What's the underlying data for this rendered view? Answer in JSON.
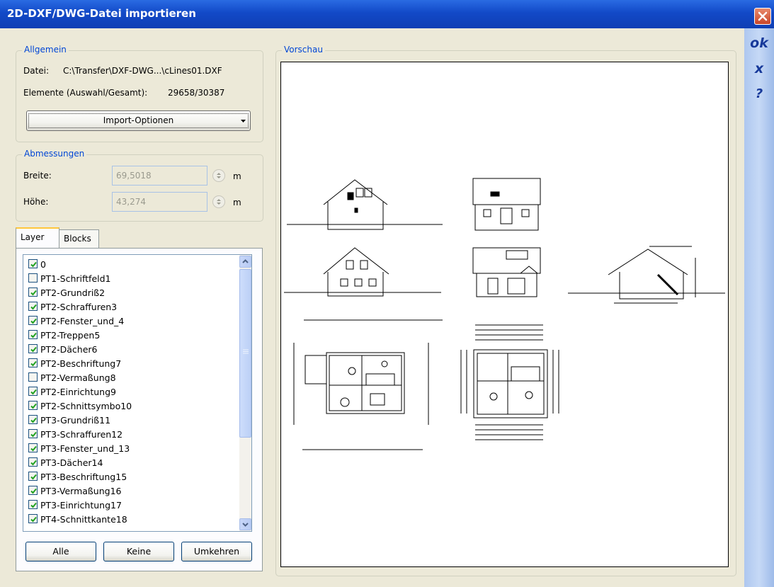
{
  "window": {
    "title": "2D-DXF/DWG-Datei importieren"
  },
  "side_actions": {
    "ok": "ok",
    "cancel": "x",
    "help": "?"
  },
  "allgemein": {
    "legend": "Allgemein",
    "datei_label": "Datei:",
    "datei_value": "C:\\Transfer\\DXF-DWG...\\cLines01.DXF",
    "elemente_label": "Elemente (Auswahl/Gesamt):",
    "elemente_value": "29658/30387",
    "import_options": "Import-Optionen"
  },
  "abmessungen": {
    "legend": "Abmessungen",
    "breite_label": "Breite:",
    "breite_value": "69,5018",
    "hoehe_label": "Höhe:",
    "hoehe_value": "43,274",
    "unit": "m"
  },
  "tabs": [
    "Layer",
    "Blocks"
  ],
  "layers": [
    {
      "name": "0",
      "checked": true
    },
    {
      "name": "PT1-Schriftfeld1",
      "checked": false
    },
    {
      "name": "PT2-Grundriß2",
      "checked": true
    },
    {
      "name": "PT2-Schraffuren3",
      "checked": true
    },
    {
      "name": "PT2-Fenster_und_4",
      "checked": true
    },
    {
      "name": "PT2-Treppen5",
      "checked": true
    },
    {
      "name": "PT2-Dächer6",
      "checked": true
    },
    {
      "name": "PT2-Beschriftung7",
      "checked": true
    },
    {
      "name": "PT2-Vermaßung8",
      "checked": false
    },
    {
      "name": "PT2-Einrichtung9",
      "checked": true
    },
    {
      "name": "PT2-Schnittsymbo10",
      "checked": true
    },
    {
      "name": "PT3-Grundriß11",
      "checked": true
    },
    {
      "name": "PT3-Schraffuren12",
      "checked": true
    },
    {
      "name": "PT3-Fenster_und_13",
      "checked": true
    },
    {
      "name": "PT3-Dächer14",
      "checked": true
    },
    {
      "name": "PT3-Beschriftung15",
      "checked": true
    },
    {
      "name": "PT3-Vermaßung16",
      "checked": true
    },
    {
      "name": "PT3-Einrichtung17",
      "checked": true
    },
    {
      "name": "PT4-Schnittkante18",
      "checked": true
    }
  ],
  "buttons": {
    "all": "Alle",
    "none": "Keine",
    "invert": "Umkehren"
  },
  "preview": {
    "legend": "Vorschau"
  },
  "colors": {
    "title_bar": "#1249c7",
    "accent_text": "#0046d5",
    "side_bar": "#aec7ef"
  }
}
